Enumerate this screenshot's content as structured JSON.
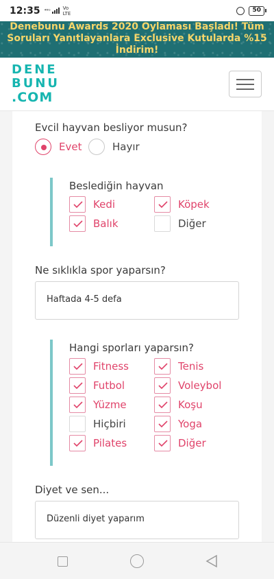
{
  "status": {
    "time": "12:35",
    "net": [
      "⁴⁶ᴳ",
      "Vo",
      "LTE"
    ],
    "battery": "50"
  },
  "banner": {
    "text": "Denebunu Awards 2020 Oylaması Başladı! Tüm Soruları Yanıtlayanlara Exclusive Kutularda %15 İndirim!"
  },
  "logo": {
    "line1": "DENE",
    "line2": "BUNU",
    "line3": ".COM"
  },
  "colors": {
    "accent": "#e0436a",
    "teal": "#16b5b0",
    "subgroup_bar": "#7cc7c8",
    "banner_bg": "#1f6f73",
    "banner_text": "#f6d66a"
  },
  "survey": {
    "pet_question": "Evcil hayvan besliyor musun?",
    "pet_options": [
      {
        "label": "Evet",
        "selected": true
      },
      {
        "label": "Hayır",
        "selected": false
      }
    ],
    "pet_group": {
      "title": "Beslediğin hayvan",
      "options": [
        {
          "label": "Kedi",
          "checked": true
        },
        {
          "label": "Köpek",
          "checked": true
        },
        {
          "label": "Balık",
          "checked": true
        },
        {
          "label": "Diğer",
          "checked": false
        }
      ]
    },
    "sport_freq_question": "Ne sıklıkla spor yaparsın?",
    "sport_freq_value": "Haftada 4-5 defa",
    "sport_group": {
      "title": "Hangi sporları yaparsın?",
      "options": [
        {
          "label": "Fitness",
          "checked": true
        },
        {
          "label": "Tenis",
          "checked": true
        },
        {
          "label": "Futbol",
          "checked": true
        },
        {
          "label": "Voleybol",
          "checked": true
        },
        {
          "label": "Yüzme",
          "checked": true
        },
        {
          "label": "Koşu",
          "checked": true
        },
        {
          "label": "Hiçbiri",
          "checked": false
        },
        {
          "label": "Yoga",
          "checked": true
        },
        {
          "label": "Pilates",
          "checked": true
        },
        {
          "label": "Diğer",
          "checked": true
        }
      ]
    },
    "diet_question": "Diyet ve sen...",
    "diet_value": "Düzenli diyet yaparım"
  },
  "navbar": {
    "icons": [
      "recent-apps-icon",
      "home-icon",
      "back-icon"
    ]
  }
}
